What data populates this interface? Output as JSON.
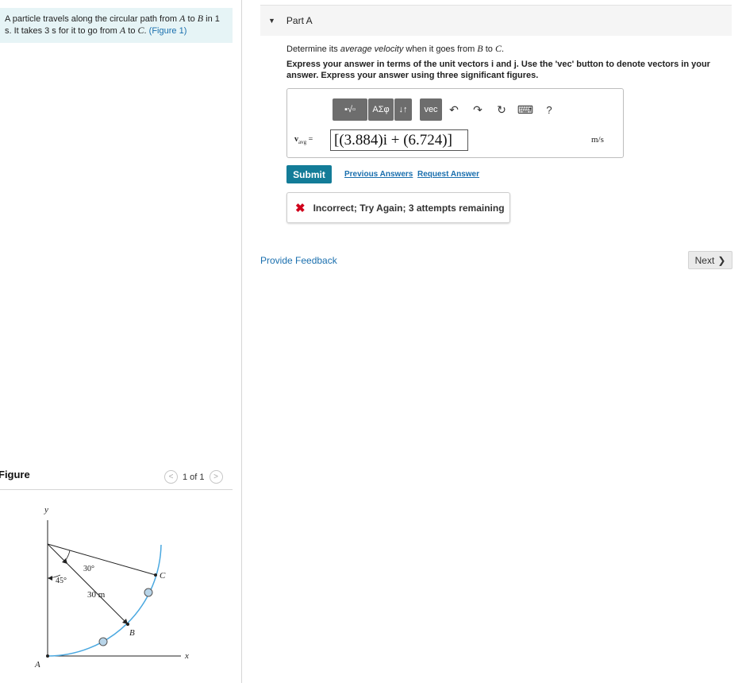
{
  "problem": {
    "part1": "A particle travels along the circular path from ",
    "a": "A",
    "part2": " to ",
    "b": "B",
    "part3": " in 1 s. It takes 3 s for it to go from ",
    "a2": "A",
    "part4": " to ",
    "c": "C",
    "part5": ". ",
    "figure_link": "(Figure 1)"
  },
  "figure": {
    "title": "Figure",
    "pager": "1 of 1",
    "prev_glyph": "<",
    "next_glyph": ">",
    "labels": {
      "y": "y",
      "x": "x",
      "A": "A",
      "B": "B",
      "C": "C",
      "angle_30": "30°",
      "angle_45": "45°",
      "radius": "30 m"
    },
    "colors": {
      "path": "#4aa8e0",
      "point_fill": "#b8d4e8"
    }
  },
  "part": {
    "toggle_glyph": "▼",
    "title": "Part A",
    "question_prefix": "Determine its ",
    "question_italic": "average velocity",
    "question_mid": " when it goes from ",
    "from": "B",
    "question_to": " to ",
    "to": "C",
    "question_end": ".",
    "instructions": "Express your answer in terms of the unit vectors i and j. Use the 'vec' button to denote vectors in your answer. Express your answer using three significant figures."
  },
  "toolbar": {
    "templates_label": "▪√▫",
    "greek_label": "ΑΣφ",
    "arrows_label": "↓↑",
    "vec_label": "vec",
    "undo_icon": "↶",
    "redo_icon": "↷",
    "reset_icon": "↻",
    "keyboard_icon": "⌨",
    "help_label": "?"
  },
  "answer": {
    "var_name": "v",
    "var_sub": "avg",
    "equals": "=",
    "value": "[(3.884)i + (6.724)]",
    "units": "m/s"
  },
  "actions": {
    "submit": "Submit",
    "previous_answers": "Previous Answers",
    "request_answer": "Request Answer"
  },
  "feedback": {
    "icon": "✖",
    "text": "Incorrect; Try Again; 3 attempts remaining"
  },
  "footer": {
    "provide_feedback": "Provide Feedback",
    "next": "Next",
    "next_glyph": "❯"
  },
  "colors": {
    "accent": "#137c98",
    "link": "#1a6fae",
    "error": "#d0021b",
    "problem_bg": "#e6f4f6"
  }
}
